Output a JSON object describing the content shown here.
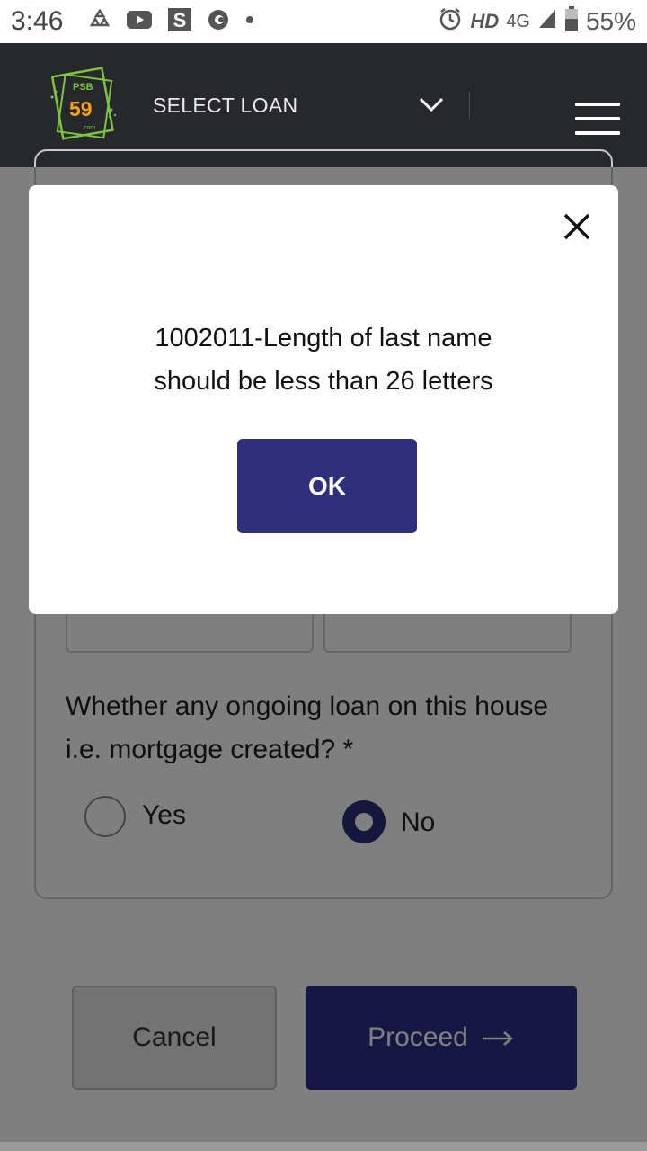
{
  "status_bar": {
    "time": "3:46",
    "network_type": "HD",
    "network_gen": "4G",
    "battery_percent": "55%",
    "icons": [
      "recycle-icon",
      "youtube-icon",
      "s-app-icon",
      "c-app-icon",
      "dot-icon",
      "alarm-icon",
      "signal-icon",
      "battery-icon"
    ]
  },
  "header": {
    "logo": {
      "line1": "PSB",
      "line2": "59",
      "line3": ".com"
    },
    "select_loan_label": "SELECT LOAN",
    "icons": [
      "chevron-down-icon",
      "hamburger-menu-icon"
    ]
  },
  "form": {
    "question": "Whether any ongoing loan on this house i.e. mortgage created? *",
    "options": [
      {
        "label": "Yes",
        "selected": false
      },
      {
        "label": "No",
        "selected": true
      }
    ],
    "cancel_label": "Cancel",
    "proceed_label": "Proceed"
  },
  "modal": {
    "message_line1": "1002011-Length of last name",
    "message_line2": "should be less than 26 letters",
    "ok_label": "OK"
  },
  "colors": {
    "header_bg": "#26282b",
    "primary": "#2f2f7c",
    "overlay": "rgba(0,0,0,0.5)",
    "logo_green": "#7dc242",
    "logo_orange": "#f7a11a"
  }
}
